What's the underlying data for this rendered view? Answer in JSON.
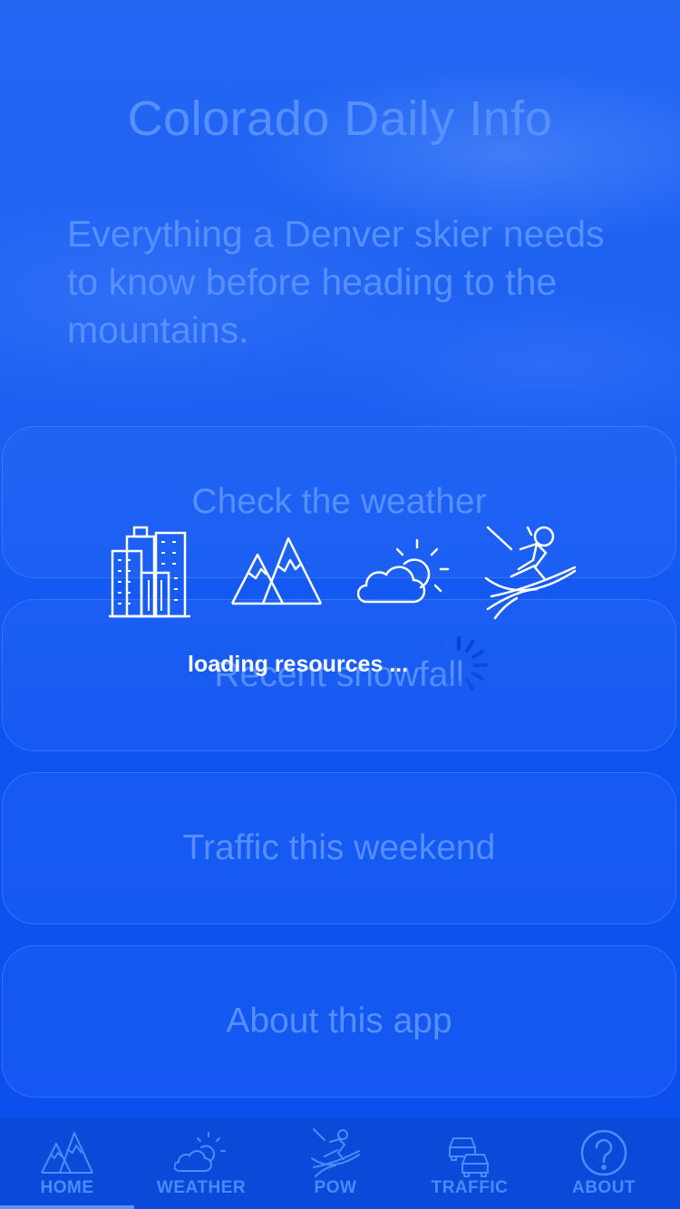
{
  "app": {
    "title": "Colorado Daily Info",
    "tagline": "Everything a Denver skier needs to know before heading to the mountains."
  },
  "cards": [
    {
      "label": "Check the weather"
    },
    {
      "label": "Recent snowfall"
    },
    {
      "label": "Traffic this weekend"
    },
    {
      "label": "About this app"
    }
  ],
  "loading": {
    "text": "loading resources ...",
    "icons": [
      "city-buildings-icon",
      "mountains-icon",
      "cloud-sun-icon",
      "skier-icon"
    ]
  },
  "tabs": [
    {
      "label": "HOME",
      "icon": "mountains-icon",
      "active": true
    },
    {
      "label": "WEATHER",
      "icon": "cloud-sun-icon",
      "active": false
    },
    {
      "label": "POW",
      "icon": "skier-icon",
      "active": false
    },
    {
      "label": "TRAFFIC",
      "icon": "cars-icon",
      "active": false
    },
    {
      "label": "ABOUT",
      "icon": "question-circle-icon",
      "active": false
    }
  ],
  "colors": {
    "background": "#1a5cf0",
    "tabbar": "#0b49d9",
    "faded_text": "#5a91ff",
    "overlay_text": "#ffffff"
  }
}
